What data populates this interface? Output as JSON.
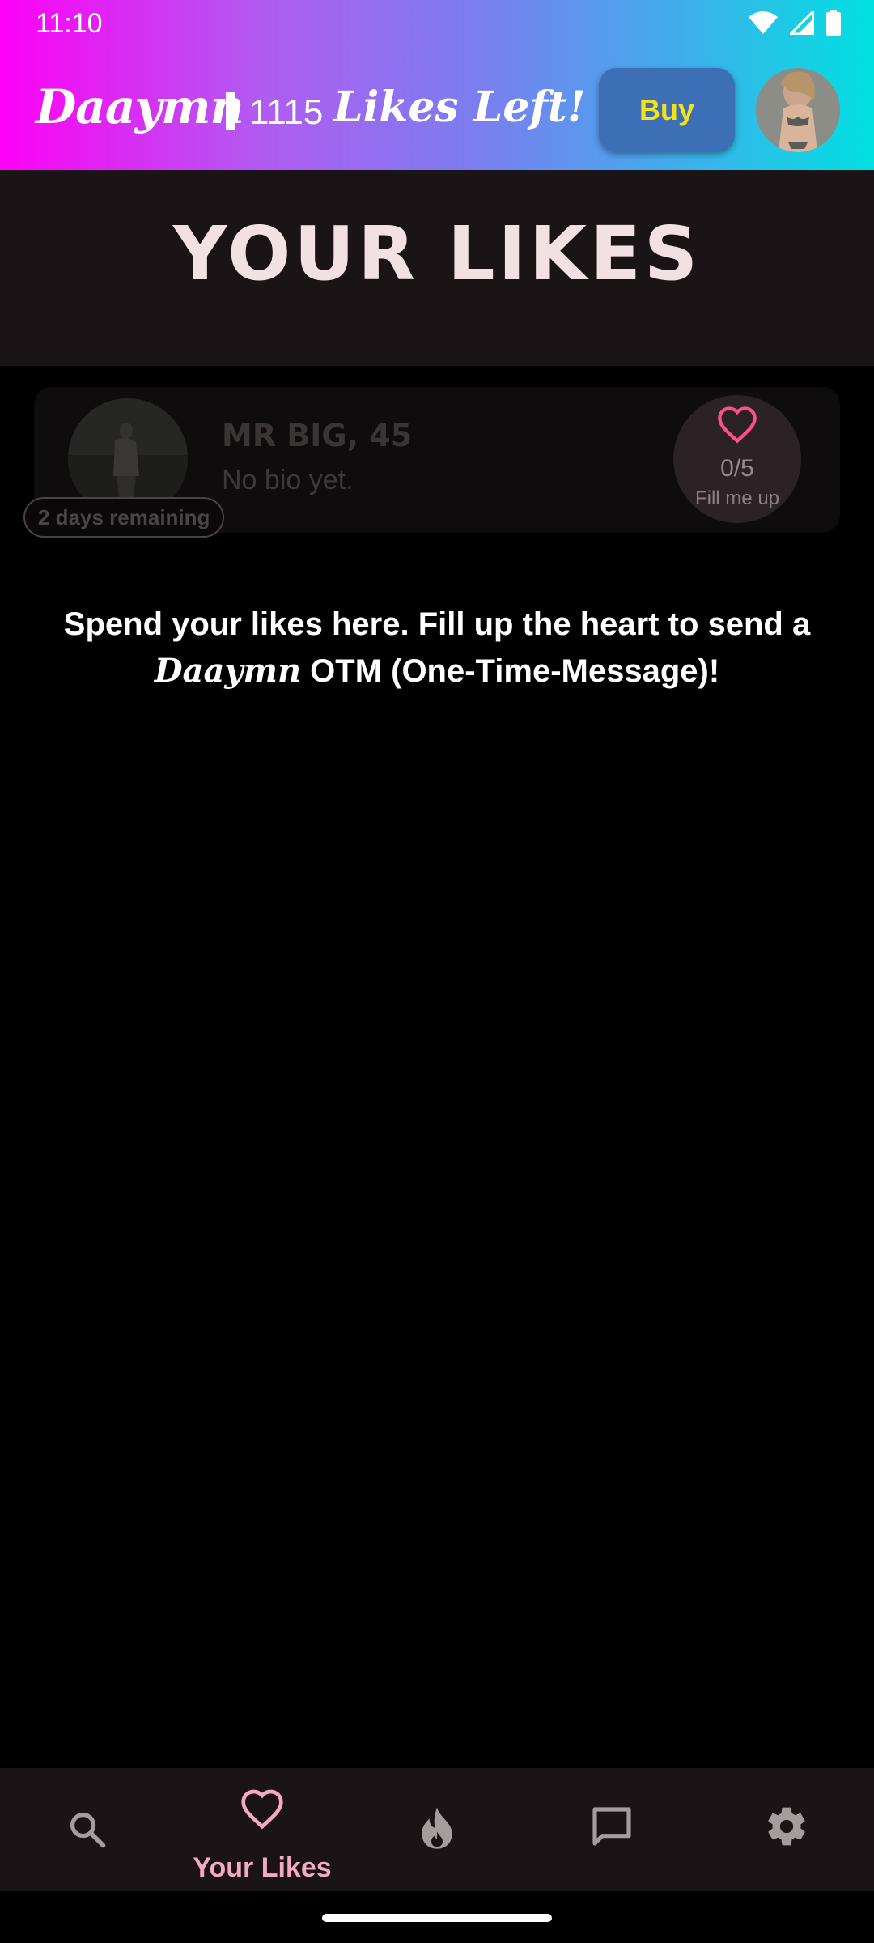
{
  "status_bar": {
    "time": "11:10"
  },
  "app_bar": {
    "brand": "Daaymn",
    "likes_count": "1115",
    "likes_left": "Likes Left!",
    "buy_label": "Buy"
  },
  "page": {
    "title": "YOUR LIKES"
  },
  "likes": [
    {
      "name": "MR BIG, 45",
      "bio": "No bio yet.",
      "progress": "0/5",
      "hint": "Fill me up",
      "remaining": "2 days remaining"
    }
  ],
  "info": {
    "line1": "Spend your likes here. Fill up the heart to send a",
    "brand": "Daaymn",
    "line2_rest": " OTM (One-Time-Message)!"
  },
  "bottom_nav": {
    "items": [
      {
        "icon": "search-icon",
        "label": ""
      },
      {
        "icon": "heart-icon",
        "label": "Your Likes",
        "active": true
      },
      {
        "icon": "flame-icon",
        "label": ""
      },
      {
        "icon": "chat-icon",
        "label": ""
      },
      {
        "icon": "gear-icon",
        "label": ""
      }
    ]
  },
  "colors": {
    "gradient_start": "#ff00f6",
    "gradient_end": "#00e0e0",
    "buy_button": "#3c6fb6",
    "buy_text": "#f4e21a",
    "accent_pink": "#f5a9c3",
    "heart_pink": "#ff4f8b",
    "surface": "#1b1416"
  }
}
